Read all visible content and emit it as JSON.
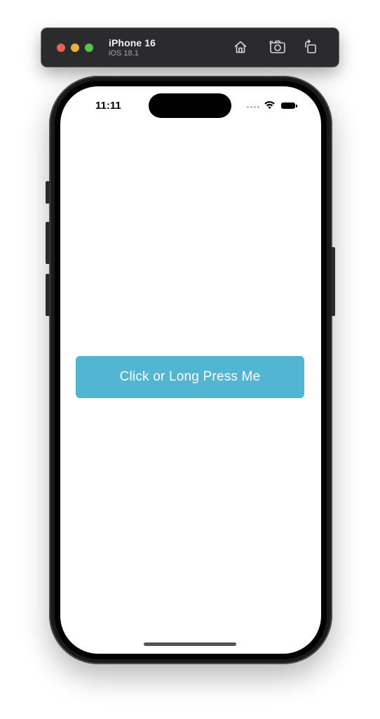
{
  "simulator": {
    "device_name": "iPhone 16",
    "os_version": "iOS 18.1",
    "toolbar_icons": [
      "home-icon",
      "screenshot-icon",
      "rotate-icon"
    ]
  },
  "status_bar": {
    "time": "11:11"
  },
  "app": {
    "button_label": "Click or Long Press Me",
    "button_color": "#52b6d3"
  }
}
